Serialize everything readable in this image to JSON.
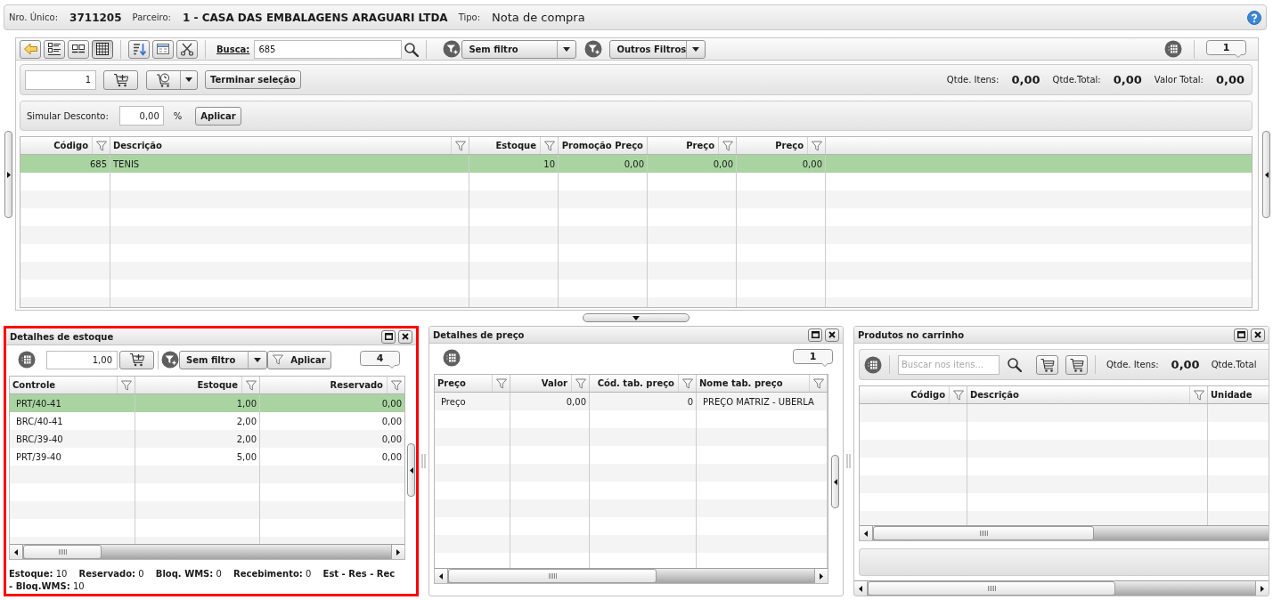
{
  "header": {
    "unique_number": {
      "label": "Nro. Único:",
      "value": "3711205"
    },
    "partner": {
      "label": "Parceiro:",
      "value": "1 - CASA DAS EMBALAGENS ARAGUARI LTDA"
    },
    "type": {
      "label": "Tipo:",
      "value": "Nota de compra"
    }
  },
  "toolbar": {
    "view_modes": [
      {
        "kind": "list",
        "selected": false
      },
      {
        "kind": "columns",
        "selected": false
      },
      {
        "kind": "grid",
        "selected": true
      }
    ],
    "search": {
      "label": "Busca:",
      "value": "685"
    },
    "filter": {
      "value": "Sem filtro"
    },
    "other_filters": {
      "label": "Outros Filtros"
    },
    "record_count": "1"
  },
  "selection_bar": {
    "quantity": "1",
    "finish_button": "Terminar seleção",
    "totals": [
      {
        "label": "Qtde. Itens:",
        "value": "0,00"
      },
      {
        "label": "Qtde.Total:",
        "value": "0,00"
      },
      {
        "label": "Valor Total:",
        "value": "0,00"
      }
    ]
  },
  "discount": {
    "label": "Simular Desconto:",
    "value": "0,00",
    "unit": "%",
    "apply_button": "Aplicar"
  },
  "products_table": {
    "columns": [
      {
        "label": "Código",
        "kind": "number",
        "filterable": true
      },
      {
        "label": "Descrição",
        "kind": "text",
        "filterable": true
      },
      {
        "label": "Estoque",
        "kind": "number",
        "filterable": true
      },
      {
        "label": "Promoção Preço",
        "kind": "number",
        "filterable": false
      },
      {
        "label": "Preço",
        "kind": "number",
        "filterable": true
      },
      {
        "label": "Preço",
        "kind": "number",
        "filterable": true
      }
    ],
    "rows": [
      {
        "cells": [
          "685",
          "TENIS",
          "10",
          "0,00",
          "0,00",
          "0,00"
        ],
        "selected": true
      }
    ]
  },
  "stock_details": {
    "title": "Detalhes de estoque",
    "highlighted": true,
    "quantity": "1,00",
    "filter": {
      "value": "Sem filtro"
    },
    "apply_button": "Aplicar",
    "record_count": "4",
    "table": {
      "columns": [
        {
          "label": "Controle",
          "kind": "text",
          "filterable": true
        },
        {
          "label": "Estoque",
          "kind": "number",
          "filterable": true
        },
        {
          "label": "Reservado",
          "kind": "number",
          "filterable": true
        }
      ],
      "rows": [
        {
          "cells": [
            "PRT/40-41",
            "1,00",
            "0,00"
          ],
          "selected": true
        },
        {
          "cells": [
            "BRC/40-41",
            "2,00",
            "0,00"
          ],
          "selected": false
        },
        {
          "cells": [
            "BRC/39-40",
            "2,00",
            "0,00"
          ],
          "selected": false
        },
        {
          "cells": [
            "PRT/39-40",
            "5,00",
            "0,00"
          ],
          "selected": false
        }
      ]
    },
    "summary": [
      {
        "label": "Estoque:",
        "value": "10"
      },
      {
        "label": "Reservado:",
        "value": "0"
      },
      {
        "label": "Bloq. WMS:",
        "value": "0"
      },
      {
        "label": "Recebimento:",
        "value": "0"
      },
      {
        "label": "Est - Res - Rec - Bloq.WMS:",
        "value": "10"
      }
    ]
  },
  "price_details": {
    "title": "Detalhes de preço",
    "highlighted": false,
    "record_count": "1",
    "table": {
      "columns": [
        {
          "label": "Preço",
          "kind": "text",
          "filterable": true
        },
        {
          "label": "Valor",
          "kind": "number",
          "filterable": true
        },
        {
          "label": "Cód. tab. preço",
          "kind": "number",
          "filterable": true
        },
        {
          "label": "Nome tab. preço",
          "kind": "text",
          "filterable": true
        }
      ],
      "rows": [
        {
          "cells": [
            "Preço",
            "0,00",
            "0",
            "PREÇO MATRIZ - UBERLA"
          ],
          "selected": false
        }
      ]
    }
  },
  "cart": {
    "title": "Produtos no carrinho",
    "highlighted": false,
    "search": {
      "placeholder": "Buscar nos itens..."
    },
    "totals": [
      {
        "label": "Qtde. Itens:",
        "value": "0,00"
      },
      {
        "label": "Qtde.Total"
      }
    ],
    "table": {
      "columns": [
        {
          "label": "Código",
          "kind": "number",
          "filterable": true
        },
        {
          "label": "Descrição",
          "kind": "text",
          "filterable": true
        },
        {
          "label": "Unidade",
          "kind": "text"
        }
      ]
    }
  }
}
